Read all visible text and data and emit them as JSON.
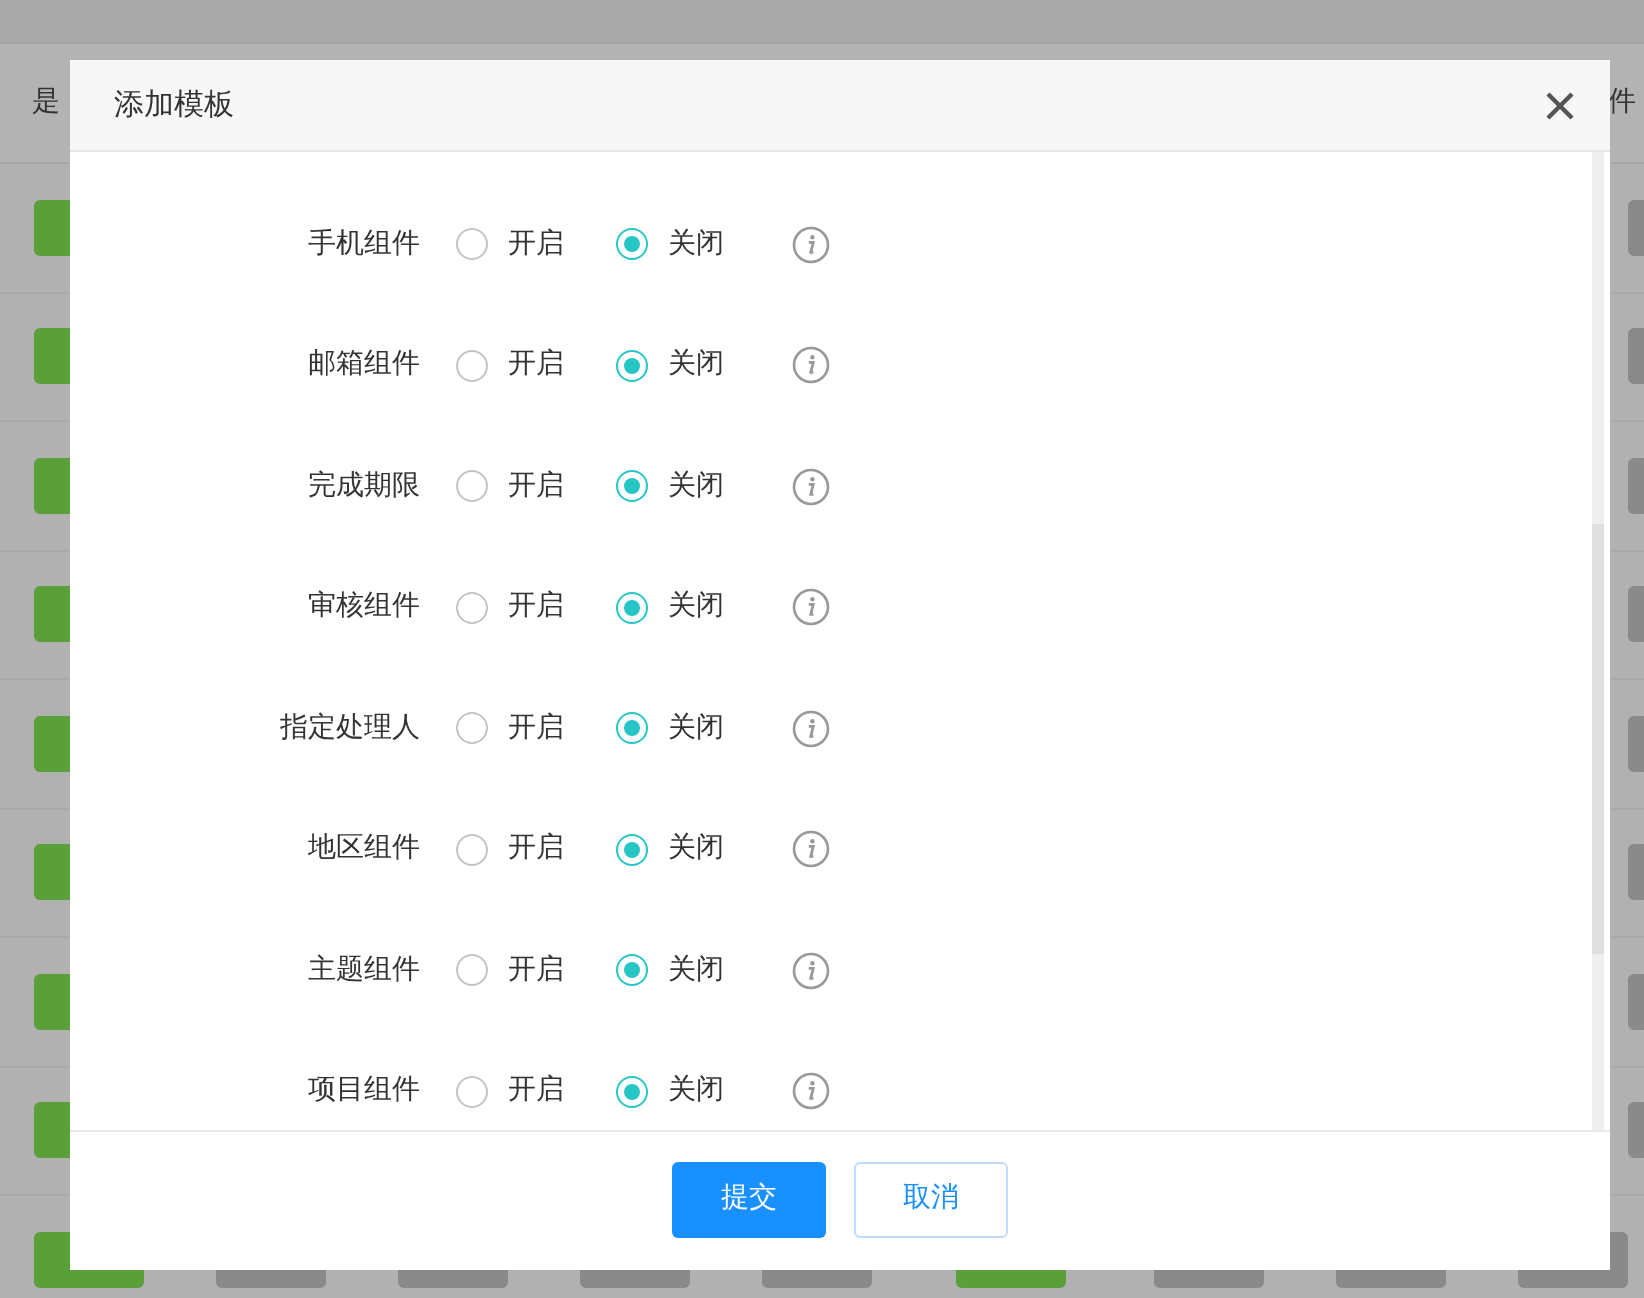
{
  "background_table": {
    "header": [
      "是",
      "件"
    ],
    "rows": [
      {
        "edge_tags": [
          {
            "color": "#5b9f3b"
          },
          {
            "color": "#8a8a8a"
          }
        ]
      },
      {
        "edge_tags": [
          {
            "color": "#5b9f3b"
          },
          {
            "color": "#8a8a8a"
          }
        ]
      },
      {
        "edge_tags": [
          {
            "color": "#5b9f3b"
          },
          {
            "color": "#8a8a8a"
          }
        ]
      },
      {
        "edge_tags": [
          {
            "color": "#5b9f3b"
          },
          {
            "color": "#8a8a8a"
          }
        ]
      },
      {
        "edge_tags": [
          {
            "color": "#5b9f3b"
          },
          {
            "color": "#8a8a8a"
          }
        ]
      },
      {
        "edge_tags": [
          {
            "color": "#5b9f3b"
          },
          {
            "color": "#8a8a8a"
          }
        ]
      },
      {
        "edge_tags": [
          {
            "color": "#5b9f3b"
          },
          {
            "color": "#8a8a8a"
          }
        ]
      },
      {
        "edge_tags": [
          {
            "color": "#5b9f3b"
          },
          {
            "color": "#8a8a8a"
          }
        ]
      }
    ],
    "bottom_row": {
      "tags": [
        {
          "color": "#5b9f3b"
        },
        {
          "color": "#8a8a8a"
        },
        {
          "color": "#8a8a8a"
        },
        {
          "color": "#8a8a8a"
        },
        {
          "color": "#8a8a8a"
        },
        {
          "color": "#5b9f3b"
        },
        {
          "color": "#8a8a8a"
        },
        {
          "color": "#8a8a8a"
        },
        {
          "color": "#8a8a8a"
        }
      ]
    }
  },
  "dialog": {
    "title": "添加模板",
    "fields": [
      {
        "label": "手机组件",
        "options": [
          {
            "label": "开启",
            "selected": false
          },
          {
            "label": "关闭",
            "selected": true
          }
        ]
      },
      {
        "label": "邮箱组件",
        "options": [
          {
            "label": "开启",
            "selected": false
          },
          {
            "label": "关闭",
            "selected": true
          }
        ]
      },
      {
        "label": "完成期限",
        "options": [
          {
            "label": "开启",
            "selected": false
          },
          {
            "label": "关闭",
            "selected": true
          }
        ]
      },
      {
        "label": "审核组件",
        "options": [
          {
            "label": "开启",
            "selected": false
          },
          {
            "label": "关闭",
            "selected": true
          }
        ]
      },
      {
        "label": "指定处理人",
        "options": [
          {
            "label": "开启",
            "selected": false
          },
          {
            "label": "关闭",
            "selected": true
          }
        ]
      },
      {
        "label": "地区组件",
        "options": [
          {
            "label": "开启",
            "selected": false
          },
          {
            "label": "关闭",
            "selected": true
          }
        ]
      },
      {
        "label": "主题组件",
        "options": [
          {
            "label": "开启",
            "selected": false
          },
          {
            "label": "关闭",
            "selected": true
          }
        ]
      },
      {
        "label": "项目组件",
        "options": [
          {
            "label": "开启",
            "selected": false
          },
          {
            "label": "关闭",
            "selected": true
          }
        ]
      }
    ],
    "buttons": [
      {
        "label": "提交",
        "kind": "primary"
      },
      {
        "label": "取消",
        "kind": "secondary"
      }
    ]
  }
}
